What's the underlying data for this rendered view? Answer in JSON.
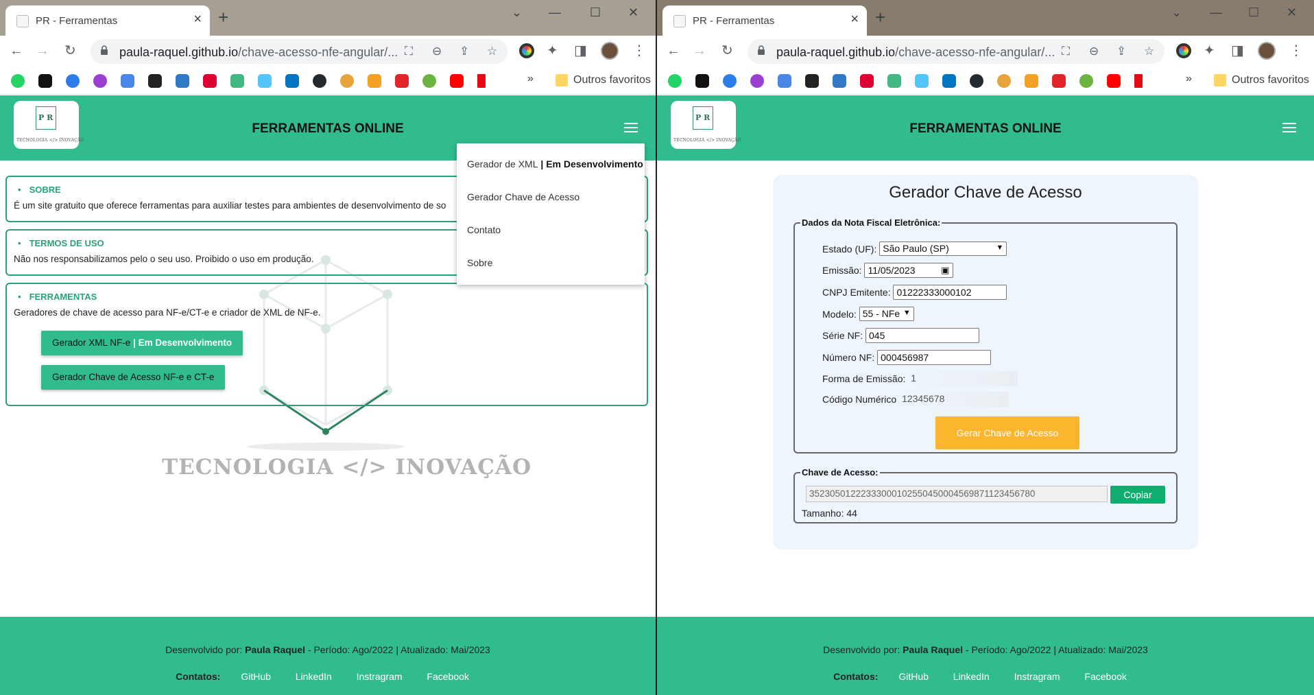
{
  "left_window": {
    "tab_title": "PR - Ferramentas",
    "url_host": "paula-raquel.github.io",
    "url_path": "/chave-acesso-nfe-angular/...",
    "bookmarks_other": "Outros favoritos",
    "site_title": "FERRAMENTAS ONLINE",
    "logo_text": "TECNOLOGIA </> INOVAÇÃO",
    "menu": {
      "item1_label": "Gerador de XML",
      "item1_badge": " | Em Desenvolvimento",
      "item2_label": "Gerador Chave de Acesso",
      "item3_label": "Contato",
      "item4_label": "Sobre"
    },
    "sobre": {
      "title": "SOBRE",
      "text": "É um site gratuito que oferece ferramentas para auxiliar testes para ambientes de desenvolvimento de so"
    },
    "termos": {
      "title": "TERMOS DE USO",
      "text": "Não nos responsabilizamos pelo o seu uso. Proibido o uso em produção."
    },
    "ferramentas": {
      "title": "FERRAMENTAS",
      "text": "Geradores de chave de acesso para NF-e/CT-e e criador de XML de NF-e.",
      "btn_xml": "Gerador XML NF-e",
      "btn_xml_badge": " | Em Desenvolvimento",
      "btn_chave": "Gerador Chave de Acesso NF-e e CT-e"
    },
    "watermark_letters": "P R",
    "watermark_text": "TECNOLOGIA </> INOVAÇÃO",
    "footer": {
      "dev_prefix": "Desenvolvido por: ",
      "dev_name": "Paula Raquel",
      "dev_suffix": " - Período: Ago/2022 | Atualizado: Mai/2023",
      "contacts_label": "Contatos:",
      "links": [
        "GitHub",
        "LinkedIn",
        "Instragram",
        "Facebook"
      ]
    }
  },
  "right_window": {
    "tab_title": "PR - Ferramentas",
    "url_host": "paula-raquel.github.io",
    "url_path": "/chave-acesso-nfe-angular/...",
    "bookmarks_other": "Outros favoritos",
    "site_title": "FERRAMENTAS ONLINE",
    "logo_text": "TECNOLOGIA </> INOVAÇÃO",
    "form": {
      "heading": "Gerador Chave de Acesso",
      "legend": "Dados da Nota Fiscal Eletrônica:",
      "estado_label": "Estado (UF):",
      "estado_value": "São Paulo (SP)",
      "emissao_label": "Emissão:",
      "emissao_value": "11/05/2023",
      "cnpj_label": "CNPJ Emitente:",
      "cnpj_value": "01222333000102",
      "modelo_label": "Modelo:",
      "modelo_value": "55 - NFe",
      "serie_label": "Série NF:",
      "serie_value": "045",
      "numero_label": "Número NF:",
      "numero_value": "000456987",
      "forma_label": "Forma de Emissão:",
      "forma_value": "1",
      "codigo_label": "Código Numérico",
      "codigo_value": "12345678",
      "submit": "Gerar Chave de Acesso"
    },
    "result": {
      "legend": "Chave de Acesso:",
      "key": "35230501222333000102550450004569871123456780",
      "copy": "Copiar",
      "size": "Tamanho: 44"
    },
    "footer": {
      "dev_prefix": "Desenvolvido por: ",
      "dev_name": "Paula Raquel",
      "dev_suffix": " - Período: Ago/2022 | Atualizado: Mai/2023",
      "contacts_label": "Contatos:",
      "links": [
        "GitHub",
        "LinkedIn",
        "Instragram",
        "Facebook"
      ]
    }
  },
  "colors": {
    "brand_green": "#30bc8f",
    "card_border": "#2aa17b",
    "submit_yellow": "#fbb62e",
    "copy_green": "#10ad6f"
  }
}
